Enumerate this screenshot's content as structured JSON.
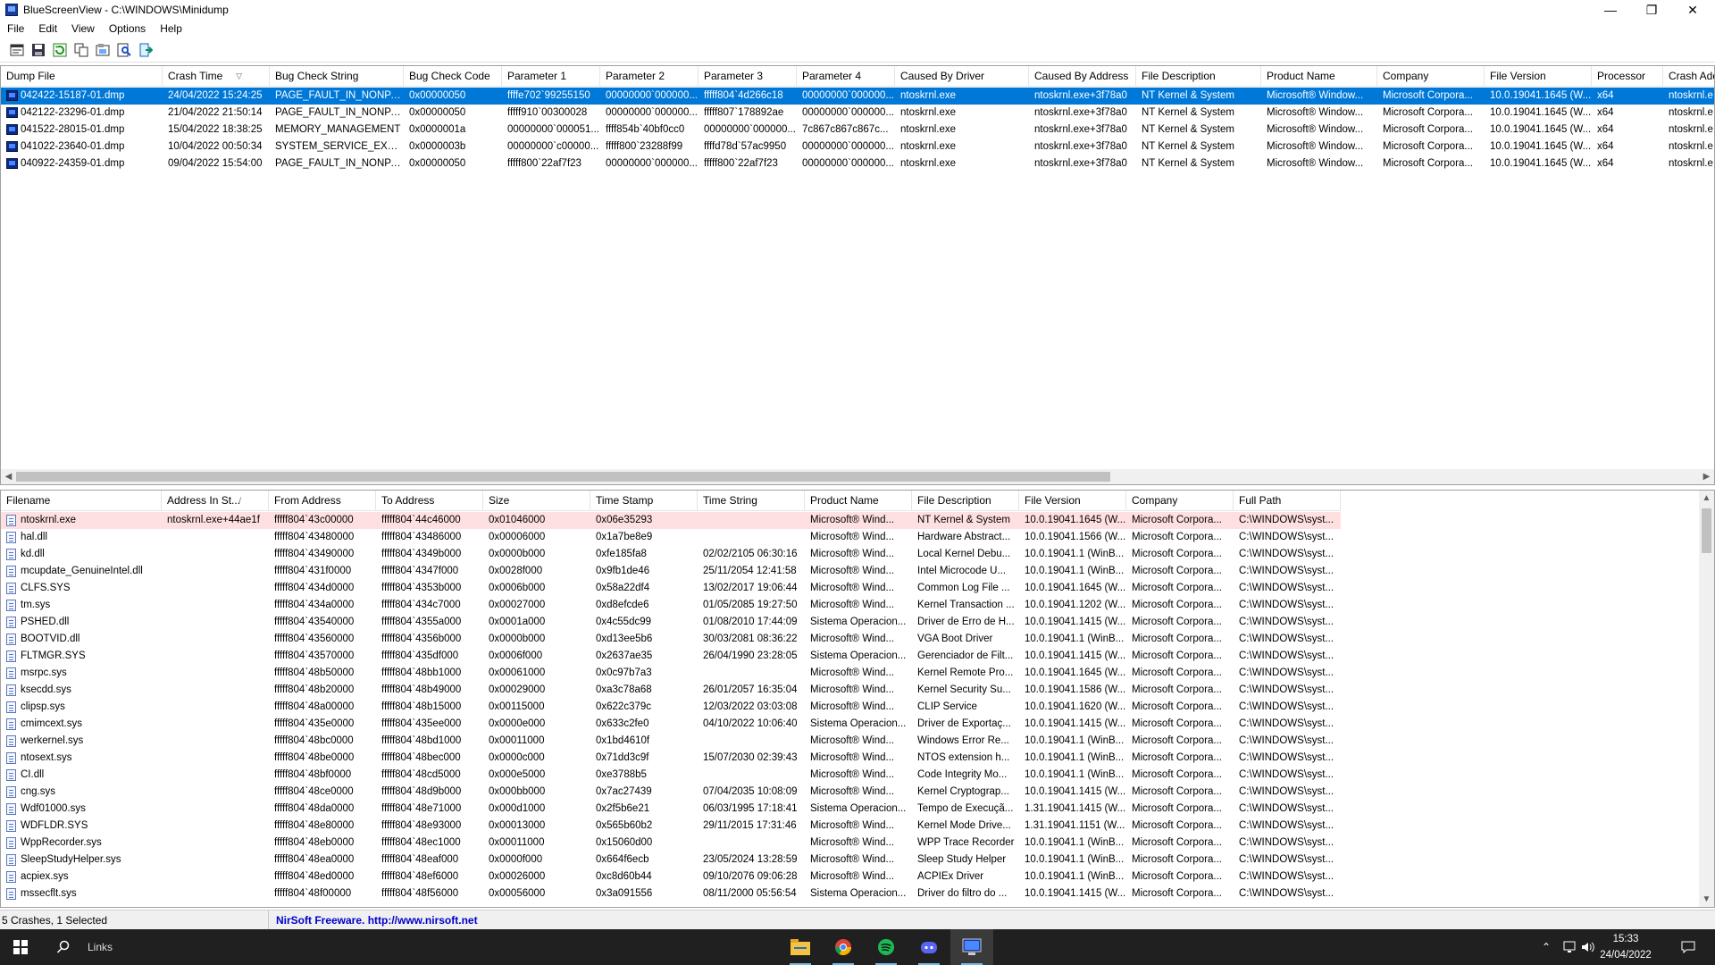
{
  "window": {
    "title": "BlueScreenView  -  C:\\WINDOWS\\Minidump",
    "min_glyph": "—",
    "max_glyph": "❐",
    "close_glyph": "✕"
  },
  "menu": [
    "File",
    "Edit",
    "View",
    "Options",
    "Help"
  ],
  "toolbar": [
    "properties-icon",
    "save-icon",
    "refresh-icon",
    "copy-icon",
    "html-report-icon",
    "find-icon",
    "exit-icon"
  ],
  "crash_list": {
    "columns": [
      {
        "label": "Dump File",
        "w": 181
      },
      {
        "label": "Crash Time",
        "w": 120,
        "sort": "▽"
      },
      {
        "label": "Bug Check String",
        "w": 150
      },
      {
        "label": "Bug Check Code",
        "w": 110
      },
      {
        "label": "Parameter 1",
        "w": 110
      },
      {
        "label": "Parameter 2",
        "w": 110
      },
      {
        "label": "Parameter 3",
        "w": 110
      },
      {
        "label": "Parameter 4",
        "w": 110
      },
      {
        "label": "Caused By Driver",
        "w": 150
      },
      {
        "label": "Caused By Address",
        "w": 120
      },
      {
        "label": "File Description",
        "w": 140
      },
      {
        "label": "Product Name",
        "w": 130
      },
      {
        "label": "Company",
        "w": 120
      },
      {
        "label": "File Version",
        "w": 120
      },
      {
        "label": "Processor",
        "w": 80
      },
      {
        "label": "Crash Add",
        "w": 60
      }
    ],
    "rows": [
      [
        "042422-15187-01.dmp",
        "24/04/2022 15:24:25",
        "PAGE_FAULT_IN_NONPA...",
        "0x00000050",
        "ffffe702`99255150",
        "00000000`000000...",
        "fffff804`4d266c18",
        "00000000`000000...",
        "ntoskrnl.exe",
        "ntoskrnl.exe+3f78a0",
        "NT Kernel & System",
        "Microsoft® Window...",
        "Microsoft Corpora...",
        "10.0.19041.1645 (W...",
        "x64",
        "ntoskrnl.e"
      ],
      [
        "042122-23296-01.dmp",
        "21/04/2022 21:50:14",
        "PAGE_FAULT_IN_NONPA...",
        "0x00000050",
        "fffff910`00300028",
        "00000000`000000...",
        "fffff807`178892ae",
        "00000000`000000...",
        "ntoskrnl.exe",
        "ntoskrnl.exe+3f78a0",
        "NT Kernel & System",
        "Microsoft® Window...",
        "Microsoft Corpora...",
        "10.0.19041.1645 (W...",
        "x64",
        "ntoskrnl.e"
      ],
      [
        "041522-28015-01.dmp",
        "15/04/2022 18:38:25",
        "MEMORY_MANAGEMENT",
        "0x0000001a",
        "00000000`000051...",
        "ffff854b`40bf0cc0",
        "00000000`000000...",
        "7c867c867c867c...",
        "ntoskrnl.exe",
        "ntoskrnl.exe+3f78a0",
        "NT Kernel & System",
        "Microsoft® Window...",
        "Microsoft Corpora...",
        "10.0.19041.1645 (W...",
        "x64",
        "ntoskrnl.e"
      ],
      [
        "041022-23640-01.dmp",
        "10/04/2022 00:50:34",
        "SYSTEM_SERVICE_EXCEP...",
        "0x0000003b",
        "00000000`c00000...",
        "fffff800`23288f99",
        "ffffd78d`57ac9950",
        "00000000`000000...",
        "ntoskrnl.exe",
        "ntoskrnl.exe+3f78a0",
        "NT Kernel & System",
        "Microsoft® Window...",
        "Microsoft Corpora...",
        "10.0.19041.1645 (W...",
        "x64",
        "ntoskrnl.e"
      ],
      [
        "040922-24359-01.dmp",
        "09/04/2022 15:54:00",
        "PAGE_FAULT_IN_NONPA...",
        "0x00000050",
        "fffff800`22af7f23",
        "00000000`000000...",
        "fffff800`22af7f23",
        "00000000`000000...",
        "ntoskrnl.exe",
        "ntoskrnl.exe+3f78a0",
        "NT Kernel & System",
        "Microsoft® Window...",
        "Microsoft Corpora...",
        "10.0.19041.1645 (W...",
        "x64",
        "ntoskrnl.e"
      ]
    ],
    "selected_index": 0
  },
  "module_list": {
    "columns": [
      {
        "label": "Filename",
        "w": 180
      },
      {
        "label": "Address In St...",
        "w": 120,
        "sort": "/"
      },
      {
        "label": "From Address",
        "w": 120
      },
      {
        "label": "To Address",
        "w": 120
      },
      {
        "label": "Size",
        "w": 120
      },
      {
        "label": "Time Stamp",
        "w": 120
      },
      {
        "label": "Time String",
        "w": 120
      },
      {
        "label": "Product Name",
        "w": 120
      },
      {
        "label": "File Description",
        "w": 120
      },
      {
        "label": "File Version",
        "w": 120
      },
      {
        "label": "Company",
        "w": 120
      },
      {
        "label": "Full Path",
        "w": 120
      }
    ],
    "rows": [
      [
        "ntoskrnl.exe",
        "ntoskrnl.exe+44ae1f",
        "fffff804`43c00000",
        "fffff804`44c46000",
        "0x01046000",
        "0x06e35293",
        "",
        "Microsoft® Wind...",
        "NT Kernel & System",
        "10.0.19041.1645 (W...",
        "Microsoft Corpora...",
        "C:\\WINDOWS\\syst..."
      ],
      [
        "hal.dll",
        "",
        "fffff804`43480000",
        "fffff804`43486000",
        "0x00006000",
        "0x1a7be8e9",
        "",
        "Microsoft® Wind...",
        "Hardware Abstract...",
        "10.0.19041.1566 (W...",
        "Microsoft Corpora...",
        "C:\\WINDOWS\\syst..."
      ],
      [
        "kd.dll",
        "",
        "fffff804`43490000",
        "fffff804`4349b000",
        "0x0000b000",
        "0xfe185fa8",
        "02/02/2105 06:30:16",
        "Microsoft® Wind...",
        "Local Kernel Debu...",
        "10.0.19041.1 (WinB...",
        "Microsoft Corpora...",
        "C:\\WINDOWS\\syst..."
      ],
      [
        "mcupdate_GenuineIntel.dll",
        "",
        "fffff804`431f0000",
        "fffff804`4347f000",
        "0x0028f000",
        "0x9fb1de46",
        "25/11/2054 12:41:58",
        "Microsoft® Wind...",
        "Intel Microcode U...",
        "10.0.19041.1 (WinB...",
        "Microsoft Corpora...",
        "C:\\WINDOWS\\syst..."
      ],
      [
        "CLFS.SYS",
        "",
        "fffff804`434d0000",
        "fffff804`4353b000",
        "0x0006b000",
        "0x58a22df4",
        "13/02/2017 19:06:44",
        "Microsoft® Wind...",
        "Common Log File ...",
        "10.0.19041.1645 (W...",
        "Microsoft Corpora...",
        "C:\\WINDOWS\\syst..."
      ],
      [
        "tm.sys",
        "",
        "fffff804`434a0000",
        "fffff804`434c7000",
        "0x00027000",
        "0xd8efcde6",
        "01/05/2085 19:27:50",
        "Microsoft® Wind...",
        "Kernel Transaction ...",
        "10.0.19041.1202 (W...",
        "Microsoft Corpora...",
        "C:\\WINDOWS\\syst..."
      ],
      [
        "PSHED.dll",
        "",
        "fffff804`43540000",
        "fffff804`4355a000",
        "0x0001a000",
        "0x4c55dc99",
        "01/08/2010 17:44:09",
        "Sistema Operacion...",
        "Driver de Erro de H...",
        "10.0.19041.1415 (W...",
        "Microsoft Corpora...",
        "C:\\WINDOWS\\syst..."
      ],
      [
        "BOOTVID.dll",
        "",
        "fffff804`43560000",
        "fffff804`4356b000",
        "0x0000b000",
        "0xd13ee5b6",
        "30/03/2081 08:36:22",
        "Microsoft® Wind...",
        "VGA Boot Driver",
        "10.0.19041.1 (WinB...",
        "Microsoft Corpora...",
        "C:\\WINDOWS\\syst..."
      ],
      [
        "FLTMGR.SYS",
        "",
        "fffff804`43570000",
        "fffff804`435df000",
        "0x0006f000",
        "0x2637ae35",
        "26/04/1990 23:28:05",
        "Sistema Operacion...",
        "Gerenciador de Filt...",
        "10.0.19041.1415 (W...",
        "Microsoft Corpora...",
        "C:\\WINDOWS\\syst..."
      ],
      [
        "msrpc.sys",
        "",
        "fffff804`48b50000",
        "fffff804`48bb1000",
        "0x00061000",
        "0x0c97b7a3",
        "",
        "Microsoft® Wind...",
        "Kernel Remote Pro...",
        "10.0.19041.1645 (W...",
        "Microsoft Corpora...",
        "C:\\WINDOWS\\syst..."
      ],
      [
        "ksecdd.sys",
        "",
        "fffff804`48b20000",
        "fffff804`48b49000",
        "0x00029000",
        "0xa3c78a68",
        "26/01/2057 16:35:04",
        "Microsoft® Wind...",
        "Kernel Security Su...",
        "10.0.19041.1586 (W...",
        "Microsoft Corpora...",
        "C:\\WINDOWS\\syst..."
      ],
      [
        "clipsp.sys",
        "",
        "fffff804`48a00000",
        "fffff804`48b15000",
        "0x00115000",
        "0x622c379c",
        "12/03/2022 03:03:08",
        "Microsoft® Wind...",
        "CLIP Service",
        "10.0.19041.1620 (W...",
        "Microsoft Corpora...",
        "C:\\WINDOWS\\syst..."
      ],
      [
        "cmimcext.sys",
        "",
        "fffff804`435e0000",
        "fffff804`435ee000",
        "0x0000e000",
        "0x633c2fe0",
        "04/10/2022 10:06:40",
        "Sistema Operacion...",
        "Driver de Exportaç...",
        "10.0.19041.1415 (W...",
        "Microsoft Corpora...",
        "C:\\WINDOWS\\syst..."
      ],
      [
        "werkernel.sys",
        "",
        "fffff804`48bc0000",
        "fffff804`48bd1000",
        "0x00011000",
        "0x1bd4610f",
        "",
        "Microsoft® Wind...",
        "Windows Error Re...",
        "10.0.19041.1 (WinB...",
        "Microsoft Corpora...",
        "C:\\WINDOWS\\syst..."
      ],
      [
        "ntosext.sys",
        "",
        "fffff804`48be0000",
        "fffff804`48bec000",
        "0x0000c000",
        "0x71dd3c9f",
        "15/07/2030 02:39:43",
        "Microsoft® Wind...",
        "NTOS extension h...",
        "10.0.19041.1 (WinB...",
        "Microsoft Corpora...",
        "C:\\WINDOWS\\syst..."
      ],
      [
        "CI.dll",
        "",
        "fffff804`48bf0000",
        "fffff804`48cd5000",
        "0x000e5000",
        "0xe3788b5",
        "",
        "Microsoft® Wind...",
        "Code Integrity Mo...",
        "10.0.19041.1 (WinB...",
        "Microsoft Corpora...",
        "C:\\WINDOWS\\syst..."
      ],
      [
        "cng.sys",
        "",
        "fffff804`48ce0000",
        "fffff804`48d9b000",
        "0x000bb000",
        "0x7ac27439",
        "07/04/2035 10:08:09",
        "Microsoft® Wind...",
        "Kernel Cryptograp...",
        "10.0.19041.1415 (W...",
        "Microsoft Corpora...",
        "C:\\WINDOWS\\syst..."
      ],
      [
        "Wdf01000.sys",
        "",
        "fffff804`48da0000",
        "fffff804`48e71000",
        "0x000d1000",
        "0x2f5b6e21",
        "06/03/1995 17:18:41",
        "Sistema Operacion...",
        "Tempo de Execuçã...",
        "1.31.19041.1415 (W...",
        "Microsoft Corpora...",
        "C:\\WINDOWS\\syst..."
      ],
      [
        "WDFLDR.SYS",
        "",
        "fffff804`48e80000",
        "fffff804`48e93000",
        "0x00013000",
        "0x565b60b2",
        "29/11/2015 17:31:46",
        "Microsoft® Wind...",
        "Kernel Mode Drive...",
        "1.31.19041.1151 (W...",
        "Microsoft Corpora...",
        "C:\\WINDOWS\\syst..."
      ],
      [
        "WppRecorder.sys",
        "",
        "fffff804`48eb0000",
        "fffff804`48ec1000",
        "0x00011000",
        "0x15060d00",
        "",
        "Microsoft® Wind...",
        "WPP Trace Recorder",
        "10.0.19041.1 (WinB...",
        "Microsoft Corpora...",
        "C:\\WINDOWS\\syst..."
      ],
      [
        "SleepStudyHelper.sys",
        "",
        "fffff804`48ea0000",
        "fffff804`48eaf000",
        "0x0000f000",
        "0x664f6ecb",
        "23/05/2024 13:28:59",
        "Microsoft® Wind...",
        "Sleep Study Helper",
        "10.0.19041.1 (WinB...",
        "Microsoft Corpora...",
        "C:\\WINDOWS\\syst..."
      ],
      [
        "acpiex.sys",
        "",
        "fffff804`48ed0000",
        "fffff804`48ef6000",
        "0x00026000",
        "0xc8d60b44",
        "09/10/2076 09:06:28",
        "Microsoft® Wind...",
        "ACPIEx Driver",
        "10.0.19041.1 (WinB...",
        "Microsoft Corpora...",
        "C:\\WINDOWS\\syst..."
      ],
      [
        "mssecflt.sys",
        "",
        "fffff804`48f00000",
        "fffff804`48f56000",
        "0x00056000",
        "0x3a091556",
        "08/11/2000 05:56:54",
        "Sistema Operacion...",
        "Driver do filtro do ...",
        "10.0.19041.1415 (W...",
        "Microsoft Corpora...",
        "C:\\WINDOWS\\syst..."
      ]
    ],
    "highlight_index": 0
  },
  "status": {
    "left": "5 Crashes, 1 Selected",
    "right": "NirSoft Freeware.  http://www.nirsoft.net"
  },
  "taskbar": {
    "search_label": "Links",
    "apps": [
      "file-explorer-icon",
      "chrome-icon",
      "spotify-icon",
      "discord-icon",
      "bluescreenview-icon"
    ],
    "time": "15:33",
    "date": "24/04/2022"
  }
}
